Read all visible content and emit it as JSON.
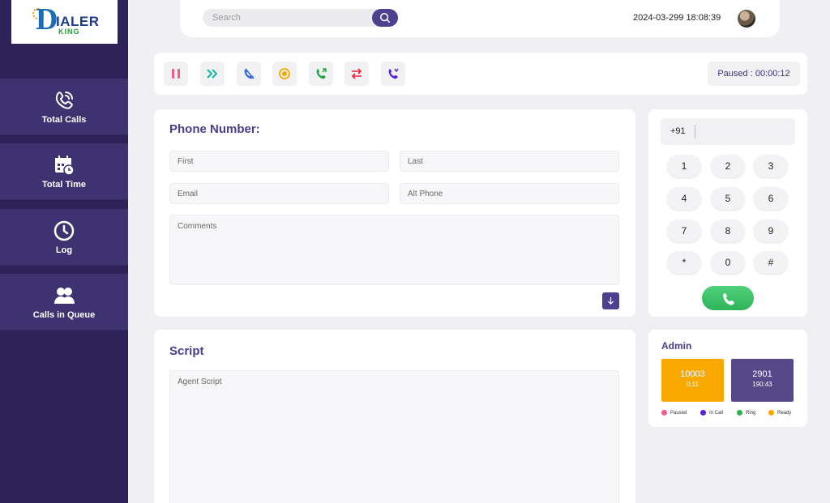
{
  "brand": {
    "name": "IALER",
    "sub": "KING"
  },
  "sidebar": {
    "items": [
      {
        "label": "Total Calls"
      },
      {
        "label": "Total Time"
      },
      {
        "label": "Log"
      },
      {
        "label": "Calls in Queue"
      }
    ]
  },
  "header": {
    "search_placeholder": "Search",
    "datetime": "2024-03-299 18:08:39"
  },
  "toolbar": {
    "status": "Paused : 00:00:12",
    "icons": [
      "pause-icon",
      "forward-icon",
      "hangup-icon",
      "record-icon",
      "call-icon",
      "transfer-icon",
      "conference-icon"
    ]
  },
  "form": {
    "title": "Phone Number:",
    "first_placeholder": "First",
    "last_placeholder": "Last",
    "email_placeholder": "Email",
    "alt_phone_placeholder": "Alt Phone",
    "comments_placeholder": "Comments"
  },
  "dialpad": {
    "prefix": "+91",
    "keys": [
      "1",
      "2",
      "3",
      "4",
      "5",
      "6",
      "7",
      "8",
      "9",
      "*",
      "0",
      "#"
    ]
  },
  "script": {
    "title": "Script",
    "placeholder": "Agent Script"
  },
  "admin": {
    "title": "Admin",
    "agents": [
      {
        "id": "10003",
        "time": "0:11",
        "color": "#f9a800"
      },
      {
        "id": "2901",
        "time": "190:43",
        "color": "#574889"
      }
    ],
    "legend": [
      {
        "label": "Paused",
        "color": "#f05a8c"
      },
      {
        "label": "In Call",
        "color": "#5b1fd6"
      },
      {
        "label": "Ring",
        "color": "#28b24a"
      },
      {
        "label": "Ready",
        "color": "#f9a800"
      }
    ]
  },
  "colors": {
    "sidebar": "#2e2358",
    "accent": "#4e3f8f",
    "call_green": "#2fb35a"
  }
}
